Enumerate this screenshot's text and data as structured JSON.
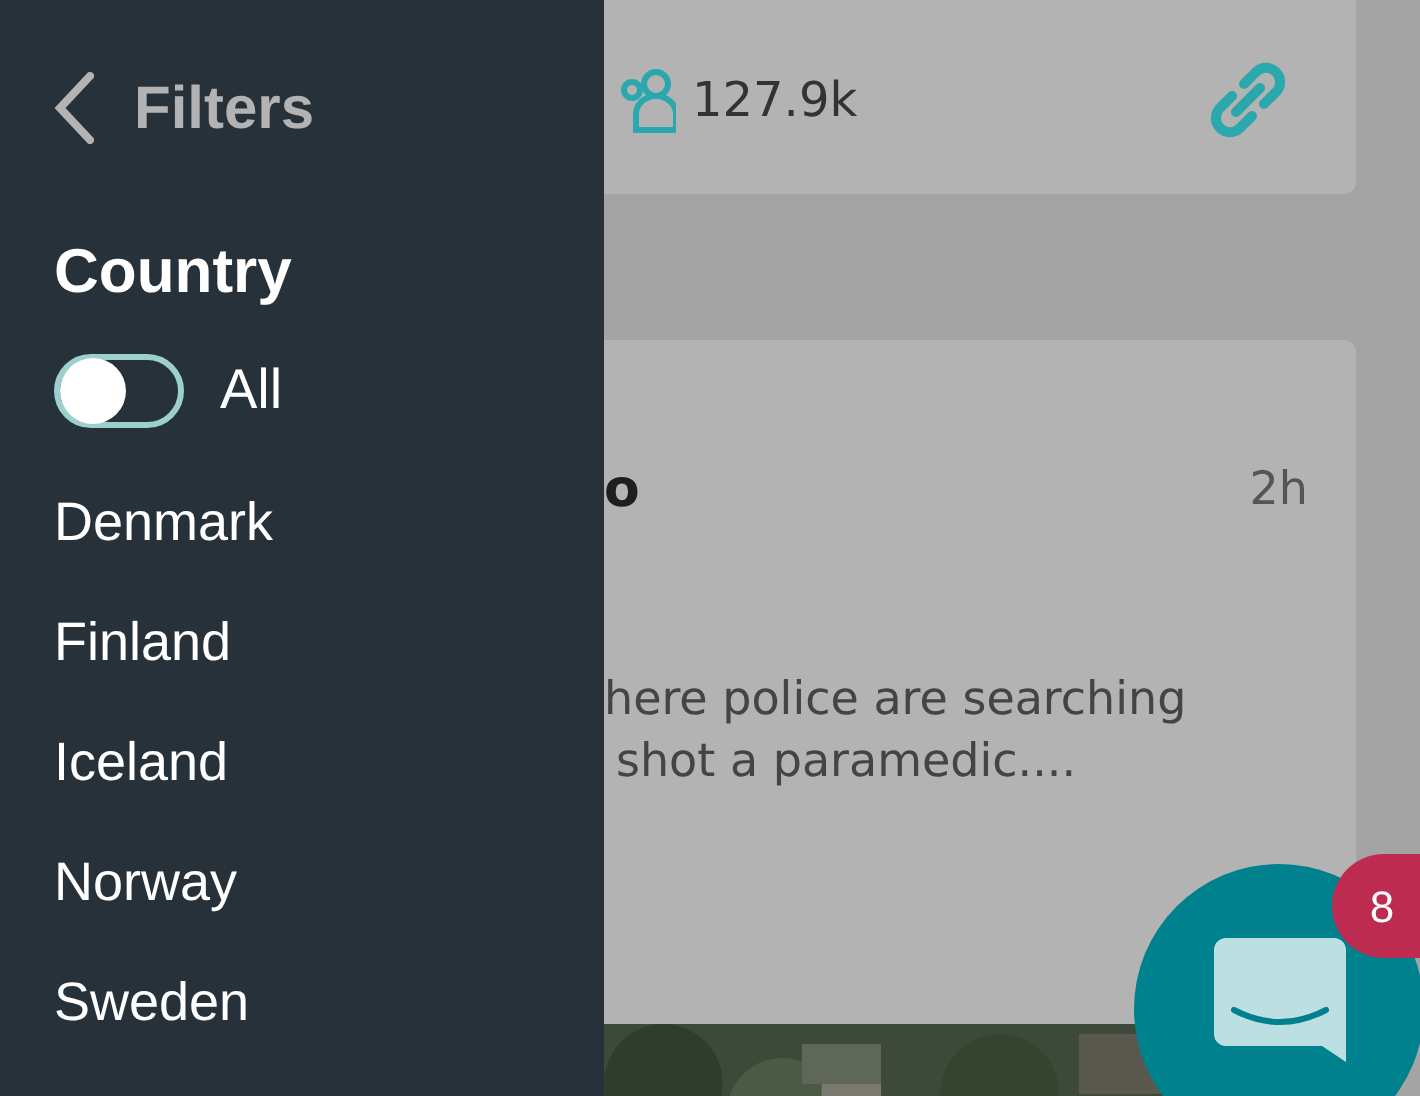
{
  "filters_panel": {
    "title": "Filters",
    "section": "Country",
    "toggle": {
      "label": "All",
      "on": false
    },
    "countries": [
      {
        "label": "Denmark"
      },
      {
        "label": "Finland"
      },
      {
        "label": "Iceland"
      },
      {
        "label": "Norway"
      },
      {
        "label": "Sweden"
      }
    ]
  },
  "feed": {
    "stats_card": {
      "followers": "127.9k"
    },
    "post_card": {
      "title": "o",
      "time": "2h",
      "excerpt": [
        "here police are searching",
        "shot a paramedic...."
      ]
    }
  },
  "chat_button": {
    "badge": "8"
  }
}
